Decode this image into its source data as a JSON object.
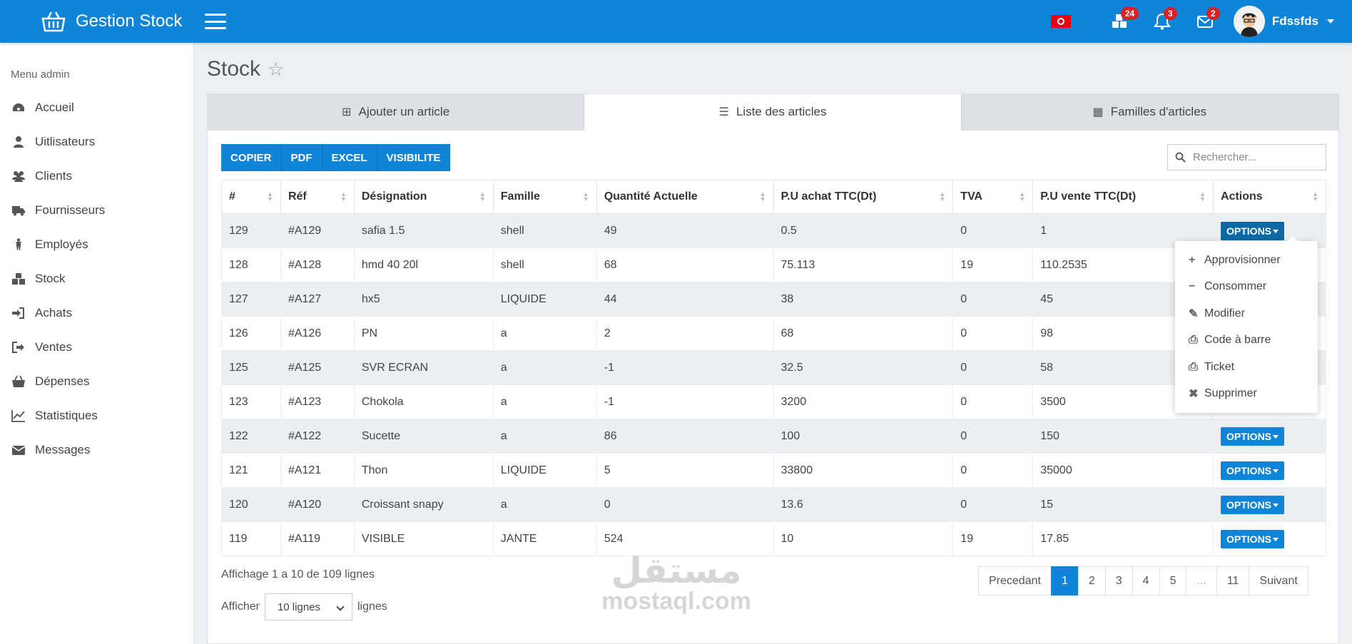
{
  "app": {
    "title": "Gestion Stock",
    "badges": {
      "stock": "24",
      "notifications": "3",
      "messages": "2"
    },
    "user": "Fdssfds"
  },
  "sidebar": {
    "title": "Menu admin",
    "items": [
      {
        "label": "Accueil",
        "icon": "dashboard-icon"
      },
      {
        "label": "Uitlisateurs",
        "icon": "user-icon"
      },
      {
        "label": "Clients",
        "icon": "users-icon"
      },
      {
        "label": "Fournisseurs",
        "icon": "truck-icon"
      },
      {
        "label": "Employés",
        "icon": "person-icon"
      },
      {
        "label": "Stock",
        "icon": "cubes-icon"
      },
      {
        "label": "Achats",
        "icon": "sign-in-icon"
      },
      {
        "label": "Ventes",
        "icon": "sign-out-icon"
      },
      {
        "label": "Dépenses",
        "icon": "basket-icon"
      },
      {
        "label": "Statistiques",
        "icon": "line-chart-icon"
      },
      {
        "label": "Messages",
        "icon": "envelope-icon"
      }
    ]
  },
  "page": {
    "title": "Stock"
  },
  "tabs": [
    {
      "label": "Ajouter un article",
      "icon": "plus-square-icon"
    },
    {
      "label": "Liste des articles",
      "icon": "list-icon"
    },
    {
      "label": "Familles d'articles",
      "icon": "grid-icon"
    }
  ],
  "toolbar": {
    "buttons": [
      "COPIER",
      "PDF",
      "EXCEL",
      "VISIBILITE"
    ]
  },
  "search": {
    "placeholder": "Rechercher..."
  },
  "table": {
    "headers": [
      "#",
      "Réf",
      "Désignation",
      "Famille",
      "Quantité Actuelle",
      "P.U achat TTC(Dt)",
      "TVA",
      "P.U vente TTC(Dt)",
      "Actions"
    ],
    "option_label": "OPTIONS",
    "rows": [
      [
        "129",
        "#A129",
        "safia 1.5",
        "shell",
        "49",
        "0.5",
        "0",
        "1"
      ],
      [
        "128",
        "#A128",
        "hmd 40 20l",
        "shell",
        "68",
        "75.113",
        "19",
        "110.2535"
      ],
      [
        "127",
        "#A127",
        "hx5",
        "LIQUIDE",
        "44",
        "38",
        "0",
        "45"
      ],
      [
        "126",
        "#A126",
        "PN",
        "a",
        "2",
        "68",
        "0",
        "98"
      ],
      [
        "125",
        "#A125",
        "SVR ECRAN",
        "a",
        "-1",
        "32.5",
        "0",
        "58"
      ],
      [
        "123",
        "#A123",
        "Chokola",
        "a",
        "-1",
        "3200",
        "0",
        "3500"
      ],
      [
        "122",
        "#A122",
        "Sucette",
        "a",
        "86",
        "100",
        "0",
        "150"
      ],
      [
        "121",
        "#A121",
        "Thon",
        "LIQUIDE",
        "5",
        "33800",
        "0",
        "35000"
      ],
      [
        "120",
        "#A120",
        "Croissant snapy",
        "a",
        "0",
        "13.6",
        "0",
        "15"
      ],
      [
        "119",
        "#A119",
        "VISIBLE",
        "JANTE",
        "524",
        "10",
        "19",
        "17.85"
      ]
    ]
  },
  "dropdown": {
    "items": [
      {
        "label": "Approvisionner",
        "icon": "+"
      },
      {
        "label": "Consommer",
        "icon": "−"
      },
      {
        "label": "Modifier",
        "icon": "✎"
      },
      {
        "label": "Code à barre",
        "icon": "⎙"
      },
      {
        "label": "Ticket",
        "icon": "⎙"
      },
      {
        "label": "Supprimer",
        "icon": "✖"
      }
    ]
  },
  "footer": {
    "info": "Affichage 1 a 10 de 109 lignes",
    "show_label": "Afficher",
    "show_value": "10 lignes",
    "show_suffix": "lignes",
    "pagination": [
      "Precedant",
      "1",
      "2",
      "3",
      "4",
      "5",
      "...",
      "11",
      "Suivant"
    ]
  },
  "watermark": {
    "arabic": "مستقل",
    "latin": "mostaql.com"
  }
}
